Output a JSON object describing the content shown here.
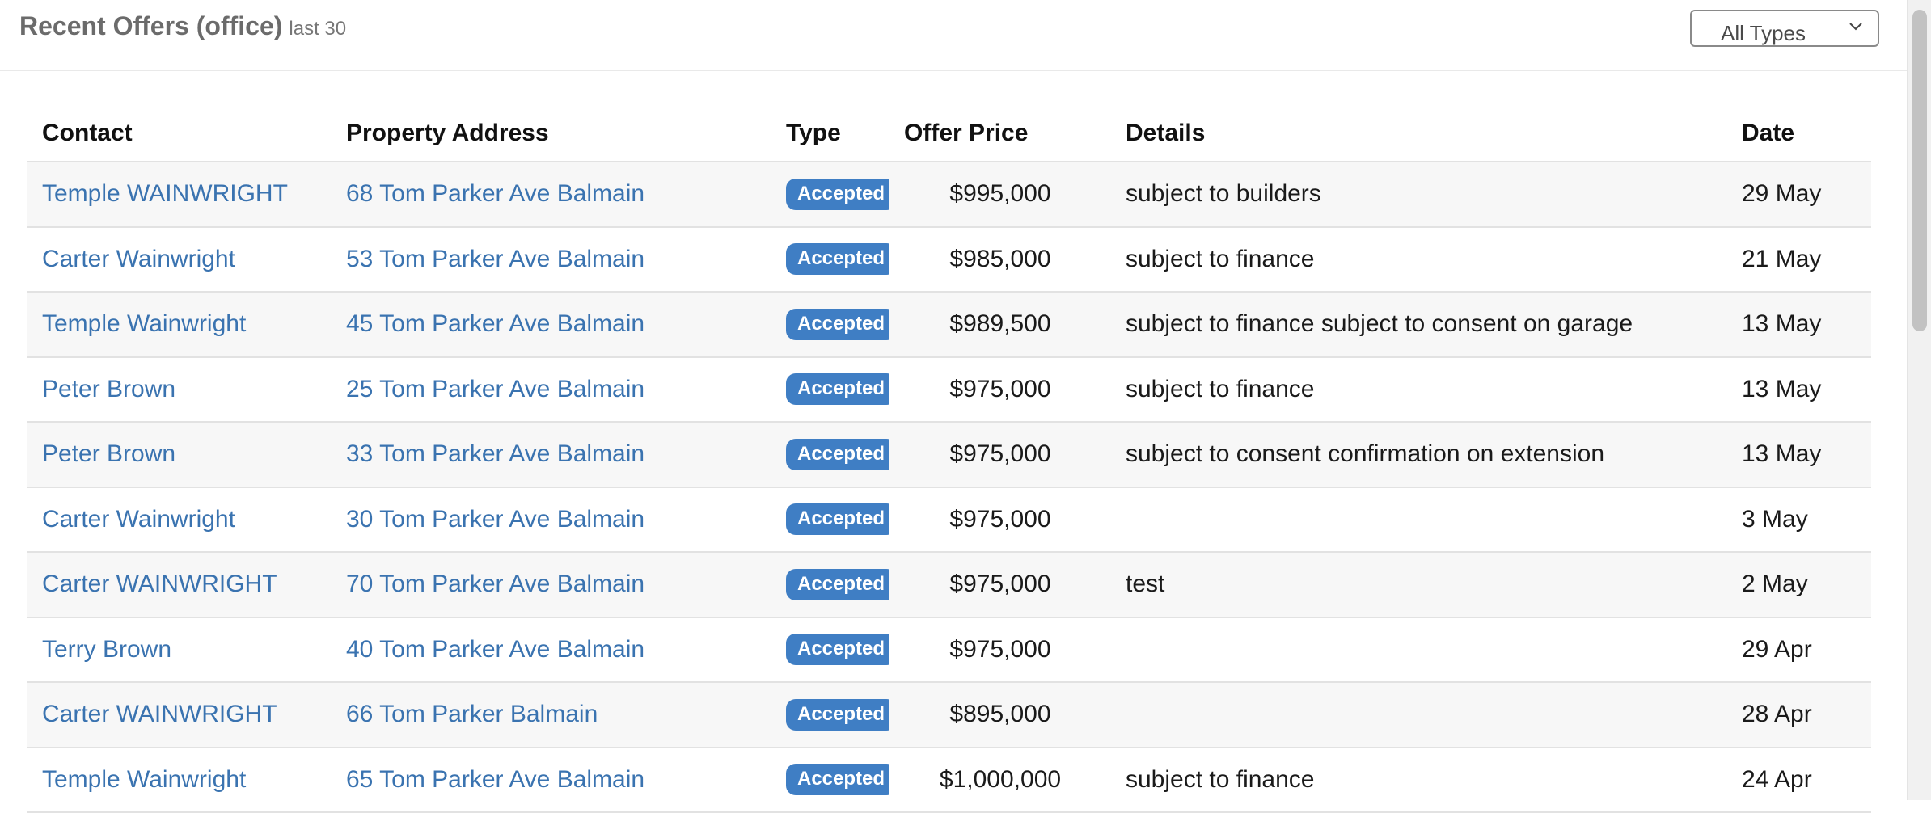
{
  "header": {
    "title": "Recent Offers (office)",
    "subtitle": "last 30"
  },
  "filter": {
    "selected": "All Types",
    "icon": "chevron-down-icon"
  },
  "table": {
    "columns": {
      "contact": "Contact",
      "address": "Property Address",
      "type": "Type",
      "price": "Offer Price",
      "details": "Details",
      "date": "Date"
    },
    "rows": [
      {
        "contact": "Temple WAINWRIGHT",
        "address": "68 Tom Parker Ave Balmain",
        "type": "Accepted",
        "price": "$995,000",
        "details": "subject to builders",
        "date": "29 May"
      },
      {
        "contact": "Carter Wainwright",
        "address": "53 Tom Parker Ave Balmain",
        "type": "Accepted",
        "price": "$985,000",
        "details": "subject to finance",
        "date": "21 May"
      },
      {
        "contact": "Temple Wainwright",
        "address": "45 Tom Parker Ave Balmain",
        "type": "Accepted",
        "price": "$989,500",
        "details": "subject to finance subject to consent on garage",
        "date": "13 May"
      },
      {
        "contact": "Peter Brown",
        "address": "25 Tom Parker Ave Balmain",
        "type": "Accepted",
        "price": "$975,000",
        "details": "subject to finance",
        "date": "13 May"
      },
      {
        "contact": "Peter Brown",
        "address": "33 Tom Parker Ave Balmain",
        "type": "Accepted",
        "price": "$975,000",
        "details": "subject to consent confirmation on extension",
        "date": "13 May"
      },
      {
        "contact": "Carter Wainwright",
        "address": "30 Tom Parker Ave Balmain",
        "type": "Accepted",
        "price": "$975,000",
        "details": "",
        "date": "3 May"
      },
      {
        "contact": "Carter WAINWRIGHT",
        "address": "70 Tom Parker Ave Balmain",
        "type": "Accepted",
        "price": "$975,000",
        "details": "test",
        "date": "2 May"
      },
      {
        "contact": "Terry Brown",
        "address": "40 Tom Parker Ave Balmain",
        "type": "Accepted",
        "price": "$975,000",
        "details": "",
        "date": "29 Apr"
      },
      {
        "contact": "Carter WAINWRIGHT",
        "address": "66 Tom Parker Balmain",
        "type": "Accepted",
        "price": "$895,000",
        "details": "",
        "date": "28 Apr"
      },
      {
        "contact": "Temple Wainwright",
        "address": "65 Tom Parker Ave Balmain",
        "type": "Accepted",
        "price": "$1,000,000",
        "details": "subject to finance",
        "date": "24 Apr"
      }
    ]
  },
  "colors": {
    "link": "#3a73b0",
    "badge": "#3f7ec4",
    "title": "#6b6b6b",
    "row_stripe": "#f7f7f7"
  }
}
